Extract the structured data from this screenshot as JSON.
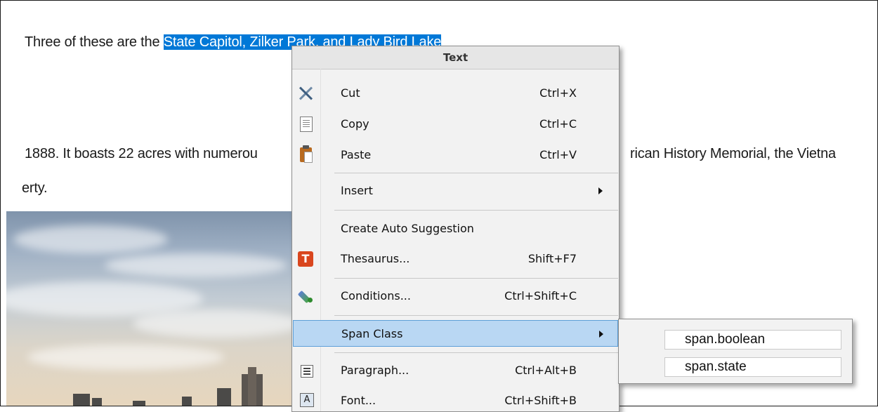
{
  "document": {
    "line1_prefix": "Three of these are the ",
    "line1_selected": "State Capitol, Zilker Park, and Lady Bird Lake",
    "line2_left": "1888. It boasts 22 acres with numerou",
    "line2_right": "rican History Memorial, the Vietna",
    "line3": "erty."
  },
  "context_menu": {
    "title": "Text",
    "items": [
      {
        "label": "Cut",
        "shortcut": "Ctrl+X",
        "icon": "cut-icon"
      },
      {
        "label": "Copy",
        "shortcut": "Ctrl+C",
        "icon": "copy-icon"
      },
      {
        "label": "Paste",
        "shortcut": "Ctrl+V",
        "icon": "paste-icon"
      },
      {
        "label": "Insert",
        "shortcut": "",
        "icon": ""
      },
      {
        "label": "Create Auto Suggestion",
        "shortcut": "",
        "icon": ""
      },
      {
        "label": "Thesaurus...",
        "shortcut": "Shift+F7",
        "icon": "thesaurus-icon"
      },
      {
        "label": "Conditions...",
        "shortcut": "Ctrl+Shift+C",
        "icon": "conditions-icon"
      },
      {
        "label": "Span Class",
        "shortcut": "",
        "icon": ""
      },
      {
        "label": "Paragraph...",
        "shortcut": "Ctrl+Alt+B",
        "icon": "paragraph-icon"
      },
      {
        "label": "Font...",
        "shortcut": "Ctrl+Shift+B",
        "icon": "font-icon"
      }
    ],
    "thesaurus_glyph": "T",
    "font_glyph": "A"
  },
  "submenu": {
    "items": [
      {
        "label": "span.boolean"
      },
      {
        "label": "span.state"
      }
    ]
  },
  "colors": {
    "selection": "#0078d7",
    "menu_highlight": "#b9d7f3",
    "menu_highlight_border": "#5c9fd8"
  }
}
